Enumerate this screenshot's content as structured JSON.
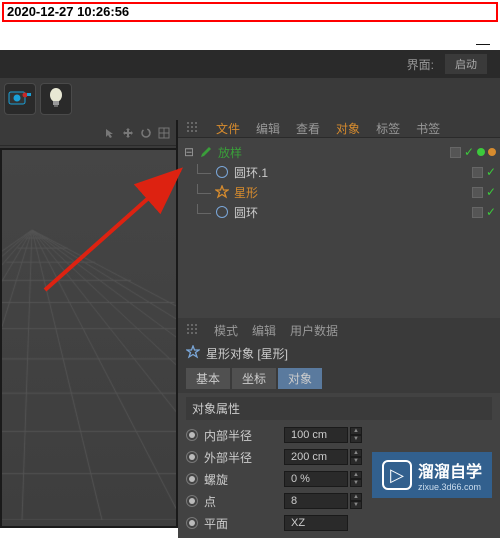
{
  "timestamp": "2020-12-27 10:26:56",
  "titlebar": {
    "ui_label": "界面:",
    "launch_btn": "启动"
  },
  "object_panel": {
    "menu": {
      "file": "文件",
      "edit": "编辑",
      "view": "查看",
      "object": "对象",
      "tags": "标签",
      "bookmark": "书签"
    },
    "tree": {
      "loft": "放样",
      "ring1": "圆环.1",
      "star": "星形",
      "ring": "圆环"
    }
  },
  "attr_panel": {
    "menu": {
      "mode": "模式",
      "edit": "编辑",
      "userdata": "用户数据"
    },
    "title": "星形对象 [星形]",
    "tabs": {
      "basic": "基本",
      "coord": "坐标",
      "object": "对象"
    },
    "section": "对象属性",
    "props": {
      "inner_radius": {
        "label": "内部半径",
        "value": "100 cm"
      },
      "outer_radius": {
        "label": "外部半径",
        "value": "200 cm"
      },
      "twist": {
        "label": "螺旋",
        "value": "0 %"
      },
      "points": {
        "label": "点",
        "value": "8"
      },
      "plane": {
        "label": "平面",
        "value": "XZ"
      }
    }
  },
  "watermark": {
    "brand": "溜溜自学",
    "url": "zixue.3d66.com"
  }
}
